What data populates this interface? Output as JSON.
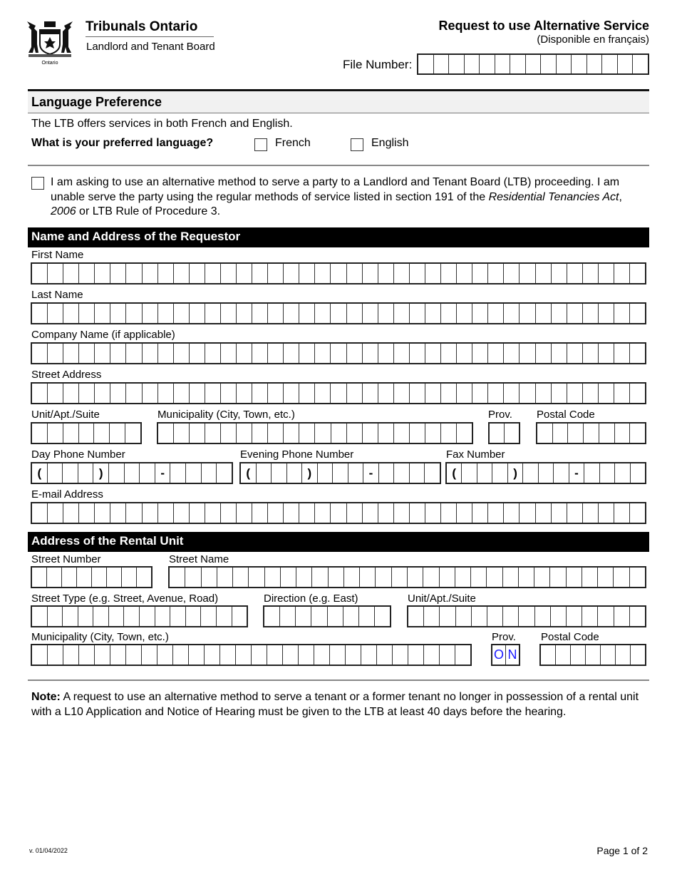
{
  "header": {
    "logo_caption": "Ontario",
    "organization": "Tribunals Ontario",
    "board": "Landlord and Tenant Board",
    "form_title": "Request to use Alternative Service",
    "form_subtitle": "(Disponible en français)",
    "file_number_label": "File Number:",
    "file_number_cells": 15
  },
  "language": {
    "heading": "Language Preference",
    "intro": "The LTB offers services in both French and English.",
    "question": "What is your preferred language?",
    "options": [
      {
        "label": "French",
        "checked": false
      },
      {
        "label": "English",
        "checked": false
      }
    ]
  },
  "request": {
    "checked": false,
    "text_part1": "I am asking to use an alternative method to serve a party to a Landlord and Tenant Board (LTB) proceeding.  I am unable serve the party using the regular methods of service listed in section 191 of the ",
    "text_italic1": "Residential Tenancies Act",
    "text_part2": ", ",
    "text_italic2": "2006",
    "text_part3": " or LTB Rule of Procedure 3."
  },
  "requestor": {
    "heading": "Name and Address of the Requestor",
    "first_name_label": "First Name",
    "last_name_label": "Last Name",
    "company_label": "Company Name (if applicable)",
    "street_label": "Street Address",
    "unit_label": "Unit/Apt./Suite",
    "municipality_label": "Municipality (City, Town, etc.)",
    "prov_label": "Prov.",
    "postal_label": "Postal Code",
    "day_phone_label": "Day Phone Number",
    "evening_phone_label": "Evening Phone Number",
    "fax_label": "Fax Number",
    "email_label": "E-mail Address",
    "phone_template": [
      "(",
      "",
      "",
      "",
      ")",
      "",
      "",
      "",
      "-",
      "",
      "",
      "",
      ""
    ]
  },
  "rental_unit": {
    "heading": "Address of the Rental Unit",
    "street_number_label": "Street Number",
    "street_name_label": "Street Name",
    "street_type_label": "Street Type (e.g. Street, Avenue, Road)",
    "direction_label": "Direction (e.g. East)",
    "unit_label": "Unit/Apt./Suite",
    "municipality_label": "Municipality (City, Town, etc.)",
    "prov_label": "Prov.",
    "prov_value": [
      "O",
      "N"
    ],
    "postal_label": "Postal Code"
  },
  "note": {
    "label": "Note:",
    "text": "  A request to use an alternative method to serve a tenant or a former tenant no longer in possession of a rental unit with a L10 Application and Notice of Hearing must be given to the LTB at least 40 days before the hearing."
  },
  "footer": {
    "version": "v. 01/04/2022",
    "page": "Page 1 of 2"
  }
}
